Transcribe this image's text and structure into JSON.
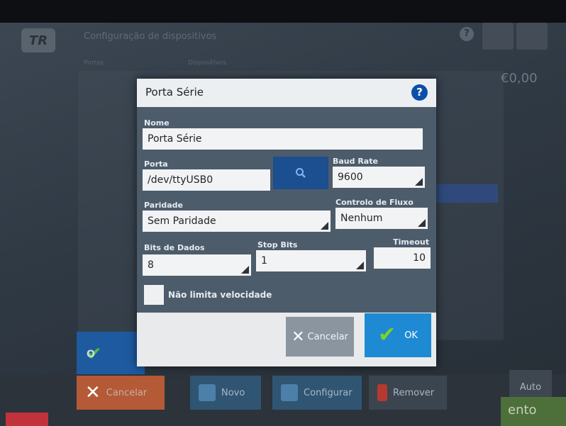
{
  "background": {
    "logo_text": "TR",
    "title": "Configuração de dispositivos",
    "help": "?",
    "columns": [
      "Portas",
      "Dispositivos"
    ],
    "amount": "€0,00",
    "ok_label": "O",
    "cancel_label": "Cancelar",
    "novo_label": "Novo",
    "configurar_label": "Configurar",
    "remover_label": "Remover",
    "auto_label": "Auto",
    "pagamento_label": "ento"
  },
  "dialog": {
    "title": "Porta Série",
    "help": "?",
    "nome": {
      "label": "Nome",
      "value": "Porta Série"
    },
    "porta": {
      "label": "Porta",
      "value": "/dev/ttyUSB0"
    },
    "baud_rate": {
      "label": "Baud Rate",
      "value": "9600"
    },
    "paridade": {
      "label": "Paridade",
      "value": "Sem Paridade"
    },
    "controlo_fluxo": {
      "label": "Controlo de Fluxo",
      "value": "Nenhum"
    },
    "bits_dados": {
      "label": "Bits de Dados",
      "value": "8"
    },
    "stop_bits": {
      "label": "Stop Bits",
      "value": "1"
    },
    "timeout": {
      "label": "Timeout",
      "value": "10"
    },
    "checkbox_label": "Não limita velocidade",
    "cancel_label": "Cancelar",
    "ok_label": "OK"
  },
  "colors": {
    "accent_blue": "#1e8ad3",
    "dialog_bg": "#4d5c6b",
    "ok_check": "#7ed321",
    "cancel_bg": "#b45a36"
  }
}
